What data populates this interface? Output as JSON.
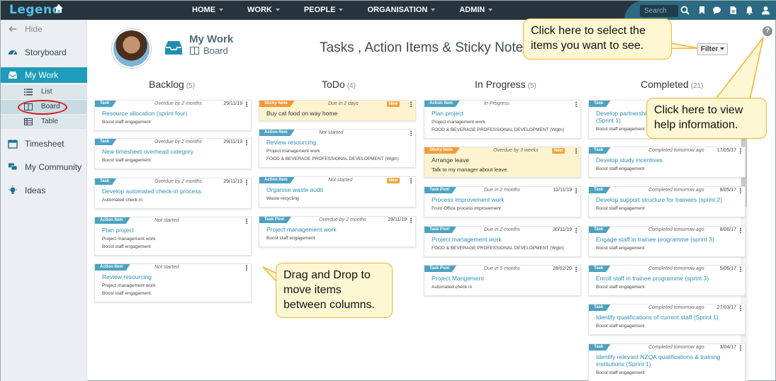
{
  "topbar": {
    "logo": "Legend",
    "nav": [
      "HOME",
      "WORK",
      "PEOPLE",
      "ORGANISATION",
      "ADMIN"
    ],
    "search_placeholder": "Search"
  },
  "sidebar": {
    "hide": "Hide",
    "storyboard": "Storyboard",
    "mywork": "My Work",
    "list": "List",
    "board": "Board",
    "table": "Table",
    "timesheet": "Timesheet",
    "community": "My Community",
    "ideas": "Ideas"
  },
  "header": {
    "title": "My Work",
    "subtitle": "Board",
    "page_title": "Tasks , Action Items & Sticky Notes",
    "filter": "Filter"
  },
  "columns": [
    {
      "name": "Backlog",
      "count": "(5)",
      "cards": [
        {
          "tag": "Task",
          "status": "Overdue by 2 months",
          "date": "29/11/19",
          "title": "Resource allocation (sprint four)",
          "lines": [
            "Boost staff engagement"
          ]
        },
        {
          "tag": "Task",
          "status": "Overdue by 2 months",
          "date": "29/11/19",
          "title": "New timesheet overhead category",
          "lines": [
            "Boost staff engagement"
          ]
        },
        {
          "tag": "Task",
          "status": "Overdue by 2 months",
          "date": "29/11/19",
          "title": "Develop automated check-in process",
          "lines": [
            "Automated check in"
          ]
        },
        {
          "tag": "Action Item",
          "status": "Not started",
          "date": "",
          "title": "Plan project",
          "lines": [
            "Project management work",
            "Boost staff engagement"
          ]
        },
        {
          "tag": "Action Item",
          "status": "Not started",
          "date": "",
          "title": "Review resourcing",
          "lines": [
            "Project management work",
            "Boost staff engagement"
          ]
        }
      ]
    },
    {
      "name": "ToDo",
      "count": "(4)",
      "cards": [
        {
          "tag": "Sticky Note",
          "status": "Due in 2 days",
          "badge": "New",
          "title": "Buy cat food on way home",
          "lines": []
        },
        {
          "tag": "Action Item",
          "status": "Not started",
          "date": "",
          "title": "Review resourcing",
          "lines": [
            "Project management work",
            "FOOD & BEVERAGE PROFESSIONAL DEVELOPMENT (Wgtn)"
          ]
        },
        {
          "tag": "Action Item",
          "status": "Not started",
          "badge": "New",
          "title": "Organise waste audit",
          "lines": [
            "Waste recycling"
          ]
        },
        {
          "tag": "Task Pool",
          "status": "Overdue by 2 months",
          "date": "29/11/19",
          "title": "Project management work",
          "lines": [
            "Boost staff engagement"
          ]
        }
      ]
    },
    {
      "name": "In Progress",
      "count": "(5)",
      "cards": [
        {
          "tag": "Action Item",
          "status": "In Progress",
          "date": "",
          "title": "Plan project",
          "lines": [
            "Project management work",
            "FOOD & BEVERAGE PROFESSIONAL DEVELOPMENT (Wgtn)"
          ]
        },
        {
          "tag": "Sticky Note",
          "status": "Overdue by 3 weeks",
          "badge": "New",
          "title": "Arrange leave",
          "lines": [
            "Talk to my manager about leave."
          ]
        },
        {
          "tag": "Task Pool",
          "status": "Due in 2 months",
          "date": "11/11/19",
          "title": "Process improvement work",
          "lines": [
            "Front Office process improvement"
          ]
        },
        {
          "tag": "Task Pool",
          "status": "Due in 2 months",
          "date": "30/11/19",
          "title": "Project management work",
          "lines": [
            "FOOD & BEVERAGE PROFESSIONAL DEVELOPMENT (Wgtn)"
          ]
        },
        {
          "tag": "Task Pool",
          "status": "Due in 5 months",
          "date": "28/02/20",
          "title": "Project Mangement",
          "lines": [
            "Automated check in"
          ]
        }
      ]
    },
    {
      "name": "Completed",
      "count": "(21)",
      "cards": [
        {
          "tag": "Task",
          "status": "",
          "date": "",
          "title": "Develop partnerships",
          "title2": "(Sprint 1)",
          "lines": [
            "Boost staff engagement"
          ]
        },
        {
          "tag": "Task",
          "status": "Completed tomorrow ago",
          "date": "17/05/17",
          "title": "Develop study incentives",
          "lines": [
            "Boost staff engagement"
          ]
        },
        {
          "tag": "Task",
          "status": "Completed tomorrow ago",
          "date": "8/05/17",
          "title": "Develop support structure for trainees (sprint 2)",
          "lines": [
            "Boost staff engagement"
          ]
        },
        {
          "tag": "Task",
          "status": "Completed tomorrow ago",
          "date": "8/06/17",
          "title": "Engage staff in trainee programme (sprint 3)",
          "lines": [
            "Boost staff engagement"
          ]
        },
        {
          "tag": "Task",
          "status": "Completed tomorrow ago",
          "date": "5/06/17",
          "title": "Enroll staff in trainee programme (sprint 3)",
          "lines": [
            "Boost staff engagement"
          ]
        },
        {
          "tag": "Task",
          "status": "Completed tomorrow ago",
          "date": "27/03/17",
          "title": "Identify qualifications of current staff (Sprint 1)",
          "lines": [
            "Boost staff engagement"
          ]
        },
        {
          "tag": "Task",
          "status": "Completed tomorrow ago",
          "date": "3/04/17",
          "title": "Identify relevant NZQA qualifications & training",
          "title2": "institutions (Sprint 1)",
          "lines": [
            "Boost staff engagement"
          ]
        }
      ]
    }
  ],
  "callouts": {
    "filter": "Click here to select the items you want to see.",
    "help": "Click here to view help information.",
    "drag": "Drag and Drop to move items between columns."
  },
  "colors": {
    "topbar": "#27333d",
    "accent": "#1f9bbb",
    "tag": "#4da2c1",
    "sticky": "#fdf3cf",
    "callout": "#fef7d3",
    "oval": "#d8151b"
  }
}
